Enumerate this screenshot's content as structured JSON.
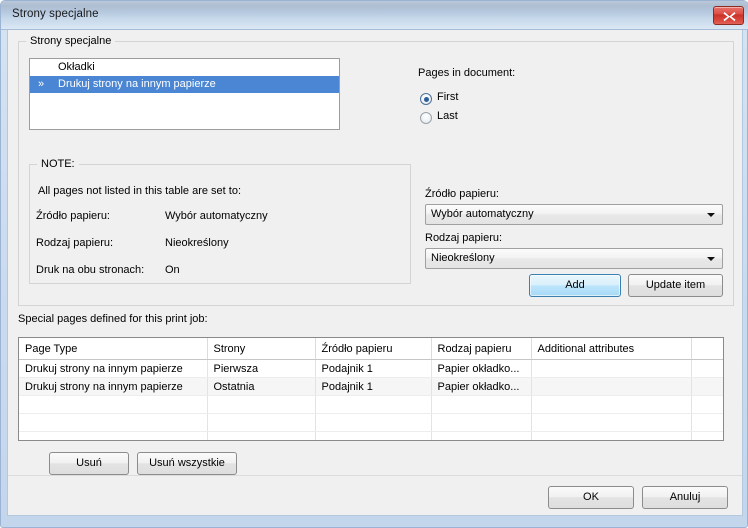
{
  "window": {
    "title": "Strony specjalne",
    "close_icon": "close-x-icon"
  },
  "special_pages_group": {
    "legend": "Strony specjalne",
    "list_items": [
      {
        "label": "Okładki",
        "selected": false,
        "marker": ""
      },
      {
        "label": "Drukuj strony na innym papierze",
        "selected": true,
        "marker": "»"
      }
    ]
  },
  "pages_in_document": {
    "label": "Pages in document:",
    "options": [
      {
        "label": "First",
        "checked": true
      },
      {
        "label": "Last",
        "checked": false
      }
    ]
  },
  "note_group": {
    "legend": "NOTE:",
    "intro": "All pages not listed in this table are set to:",
    "rows": [
      {
        "label": "Źródło papieru:",
        "value": "Wybór automatyczny"
      },
      {
        "label": "Rodzaj papieru:",
        "value": "Nieokreślony"
      },
      {
        "label": "Druk na obu stronach:",
        "value": "On"
      }
    ]
  },
  "paper_settings": {
    "source_label": "Źródło papieru:",
    "source_value": "Wybór automatyczny",
    "type_label": "Rodzaj papieru:",
    "type_value": "Nieokreślony",
    "add_button": "Add",
    "update_button": "Update item"
  },
  "special_pages_table": {
    "caption": "Special pages defined for this print job:",
    "columns": [
      "Page Type",
      "Strony",
      "Źródło papieru",
      "Rodzaj papieru",
      "Additional attributes",
      ""
    ],
    "rows": [
      [
        "Drukuj strony na innym papierze",
        "Pierwsza",
        "Podajnik 1",
        "Papier okładko...",
        "",
        ""
      ],
      [
        "Drukuj strony na innym papierze",
        "Ostatnia",
        "Podajnik 1",
        "Papier okładko...",
        "",
        ""
      ]
    ],
    "empty_rows": 4
  },
  "table_buttons": {
    "delete": "Usuń",
    "delete_all": "Usuń wszystkie"
  },
  "dialog_buttons": {
    "ok": "OK",
    "cancel": "Anuluj"
  },
  "colors": {
    "selection_blue": "#4a86d4",
    "close_red": "#c93127",
    "default_button_blue": "#3c7fb1"
  }
}
